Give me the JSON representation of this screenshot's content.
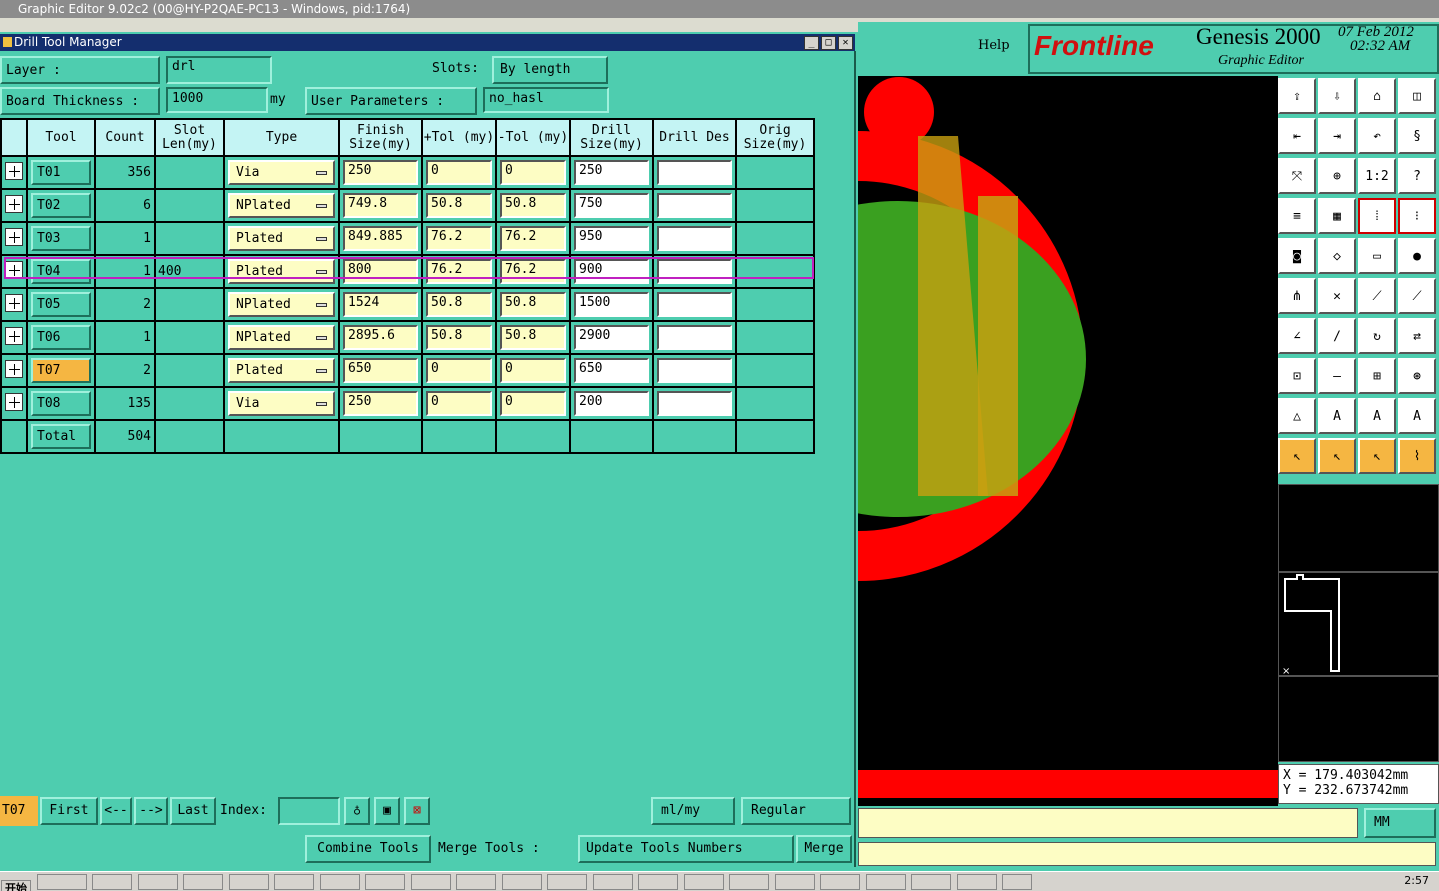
{
  "window": {
    "title": "Graphic Editor 9.02c2 (00@HY-P2QAE-PC13 - Windows, pid:1764)"
  },
  "dialog": {
    "title": "Drill Tool Manager"
  },
  "form": {
    "layer_label": "Layer          :",
    "layer_value": "drl",
    "slots_label": "Slots:",
    "slots_value": "By length",
    "thickness_label": "Board Thickness :",
    "thickness_value": "1000",
    "thickness_unit": "my",
    "userparams_label": "User Parameters :",
    "userparams_value": "no_hasl"
  },
  "table": {
    "headers": [
      "Tool",
      "Count",
      "Slot Len(my)",
      "Type",
      "Finish Size(my)",
      "+Tol (my)",
      "-Tol (my)",
      "Drill Size(my)",
      "Drill Des",
      "Orig Size(my)"
    ],
    "rows": [
      {
        "tool": "T01",
        "count": "356",
        "slot": "",
        "type": "Via",
        "finish": "250",
        "ptol": "0",
        "mtol": "0",
        "drill": "250"
      },
      {
        "tool": "T02",
        "count": "6",
        "slot": "",
        "type": "NPlated",
        "finish": "749.8",
        "ptol": "50.8",
        "mtol": "50.8",
        "drill": "750"
      },
      {
        "tool": "T03",
        "count": "1",
        "slot": "",
        "type": "Plated",
        "finish": "849.885",
        "ptol": "76.2",
        "mtol": "76.2",
        "drill": "950"
      },
      {
        "tool": "T04",
        "count": "1",
        "slot": "400",
        "type": "Plated",
        "finish": "800",
        "ptol": "76.2",
        "mtol": "76.2",
        "drill": "900"
      },
      {
        "tool": "T05",
        "count": "2",
        "slot": "",
        "type": "NPlated",
        "finish": "1524",
        "ptol": "50.8",
        "mtol": "50.8",
        "drill": "1500"
      },
      {
        "tool": "T06",
        "count": "1",
        "slot": "",
        "type": "NPlated",
        "finish": "2895.6",
        "ptol": "50.8",
        "mtol": "50.8",
        "drill": "2900"
      },
      {
        "tool": "T07",
        "count": "2",
        "slot": "",
        "type": "Plated",
        "finish": "650",
        "ptol": "0",
        "mtol": "0",
        "drill": "650"
      },
      {
        "tool": "T08",
        "count": "135",
        "slot": "",
        "type": "Via",
        "finish": "250",
        "ptol": "0",
        "mtol": "0",
        "drill": "200"
      }
    ],
    "total_label": "Total",
    "total_value": "504"
  },
  "nav": {
    "current": "T07",
    "first": "First",
    "prev": "<--",
    "next": "-->",
    "last": "Last",
    "index_label": "Index:",
    "units": "ml/my",
    "mode": "Regular"
  },
  "bottom": {
    "combine": "Combine Tools",
    "merge_label": "Merge Tools :",
    "update": "Update Tools Numbers",
    "merge": "Merge"
  },
  "right": {
    "help": "Help",
    "brand": "Frontline",
    "product": "Genesis 2000",
    "subtitle": "Graphic Editor",
    "date": "07 Feb 2012",
    "time": "02:32 AM",
    "coord_x": "X = 179.403042mm",
    "coord_y": "Y = 232.673742mm",
    "units": "MM"
  },
  "taskbar": {
    "start": "开始",
    "clock": "2:57"
  },
  "colors": {
    "bg": "#4ecdaf",
    "accent": "#f5b642",
    "highlight": "#c020c0"
  }
}
